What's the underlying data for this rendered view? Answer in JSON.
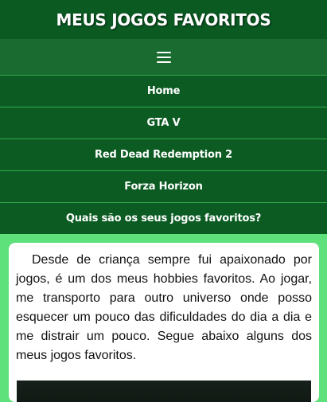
{
  "header": {
    "title": "MEUS JOGOS FAVORITOS"
  },
  "menu": {
    "icon": "hamburger-menu-icon"
  },
  "nav": {
    "items": [
      {
        "label": "Home"
      },
      {
        "label": "GTA V"
      },
      {
        "label": "Red Dead Redemption 2"
      },
      {
        "label": "Forza Horizon"
      },
      {
        "label": "Quais são os seus jogos favoritos?"
      }
    ]
  },
  "content": {
    "intro": "Desde de criança sempre fui apaixonado por jogos, é um dos meus hobbies favoritos. Ao jogar, me transporto para outro universo onde posso esquecer um pouco das dificuldades do dia a dia e me distrair um pouco. Segue abaixo alguns dos meus jogos favoritos."
  },
  "colors": {
    "header_bg": "#0a5a22",
    "menu_bg": "#1a6b30",
    "page_bg": "#5ee07a",
    "divider": "#35a84c"
  }
}
